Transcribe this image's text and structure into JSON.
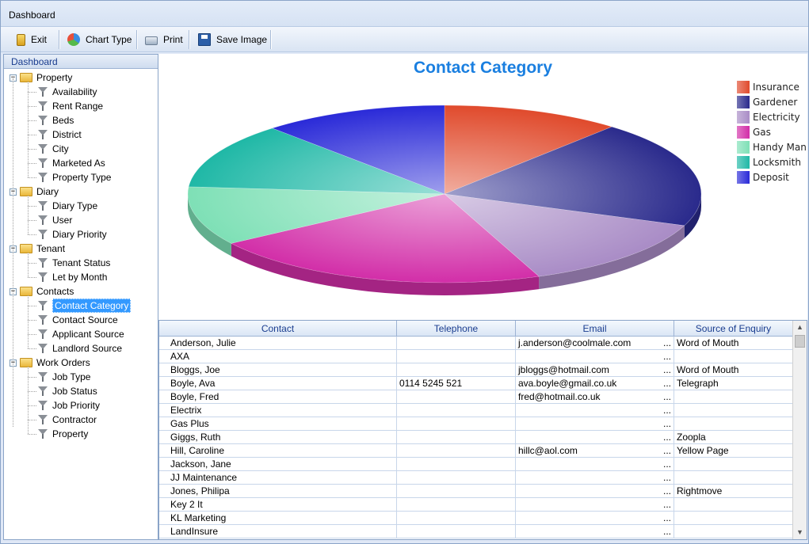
{
  "window": {
    "title": "Dashboard"
  },
  "toolbar": {
    "exit_label": "Exit",
    "chart_type_label": "Chart Type",
    "print_label": "Print",
    "save_image_label": "Save Image"
  },
  "sidebar": {
    "header": "Dashboard",
    "groups": [
      {
        "label": "Property",
        "items": [
          "Availability",
          "Rent Range",
          "Beds",
          "District",
          "City",
          "Marketed As",
          "Property Type"
        ]
      },
      {
        "label": "Diary",
        "items": [
          "Diary Type",
          "User",
          "Diary Priority"
        ]
      },
      {
        "label": "Tenant",
        "items": [
          "Tenant Status",
          "Let by Month"
        ]
      },
      {
        "label": "Contacts",
        "items": [
          "Contact Category",
          "Contact Source",
          "Applicant Source",
          "Landlord Source"
        ]
      },
      {
        "label": "Work Orders",
        "items": [
          "Job Type",
          "Job Status",
          "Job Priority",
          "Contractor",
          "Property"
        ]
      }
    ],
    "selected_item": "Contact Category"
  },
  "chart_data": {
    "type": "pie",
    "title": "Contact Category",
    "categories": [
      "Insurance",
      "Gardener",
      "Electricity",
      "Gas",
      "Handy Man",
      "Locksmith",
      "Deposit"
    ],
    "values": [
      11.3,
      19.5,
      13.2,
      21.6,
      10.7,
      12.0,
      11.7
    ],
    "colors": [
      "#e04a2c",
      "#2a2a8c",
      "#a98cc6",
      "#d22ea8",
      "#7ee0b6",
      "#1fb8a6",
      "#2a2ad8"
    ],
    "legend_position": "right"
  },
  "grid": {
    "columns": [
      "Contact",
      "Telephone",
      "Email",
      "Source of Enquiry"
    ],
    "rows": [
      [
        "Anderson, Julie",
        "",
        "j.anderson@coolmale.com",
        "Word of Mouth"
      ],
      [
        "AXA",
        "",
        "",
        ""
      ],
      [
        "Bloggs, Joe",
        "",
        "jbloggs@hotmail.com",
        "Word of Mouth"
      ],
      [
        "Boyle, Ava",
        "0114 5245 521",
        "ava.boyle@gmail.co.uk",
        "Telegraph"
      ],
      [
        "Boyle, Fred",
        "",
        "fred@hotmail.co.uk",
        ""
      ],
      [
        "Electrix",
        "",
        "",
        ""
      ],
      [
        "Gas Plus",
        "",
        "",
        ""
      ],
      [
        "Giggs, Ruth",
        "",
        "",
        "Zoopla"
      ],
      [
        "Hill, Caroline",
        "",
        "hillc@aol.com",
        "Yellow Page"
      ],
      [
        "Jackson, Jane",
        "",
        "",
        ""
      ],
      [
        "JJ Maintenance",
        "",
        "",
        ""
      ],
      [
        "Jones, Philipa",
        "",
        "",
        "Rightmove"
      ],
      [
        "Key 2 It",
        "",
        "",
        ""
      ],
      [
        "KL Marketing",
        "",
        "",
        ""
      ],
      [
        "LandInsure",
        "",
        "",
        ""
      ]
    ],
    "ellipsis": "..."
  },
  "icons": {
    "exit": "exit-door-icon",
    "chart_type": "pie-chart-icon",
    "print": "printer-icon",
    "save_image": "floppy-disk-icon",
    "group": "folder-icon",
    "item": "filter-funnel-icon"
  }
}
